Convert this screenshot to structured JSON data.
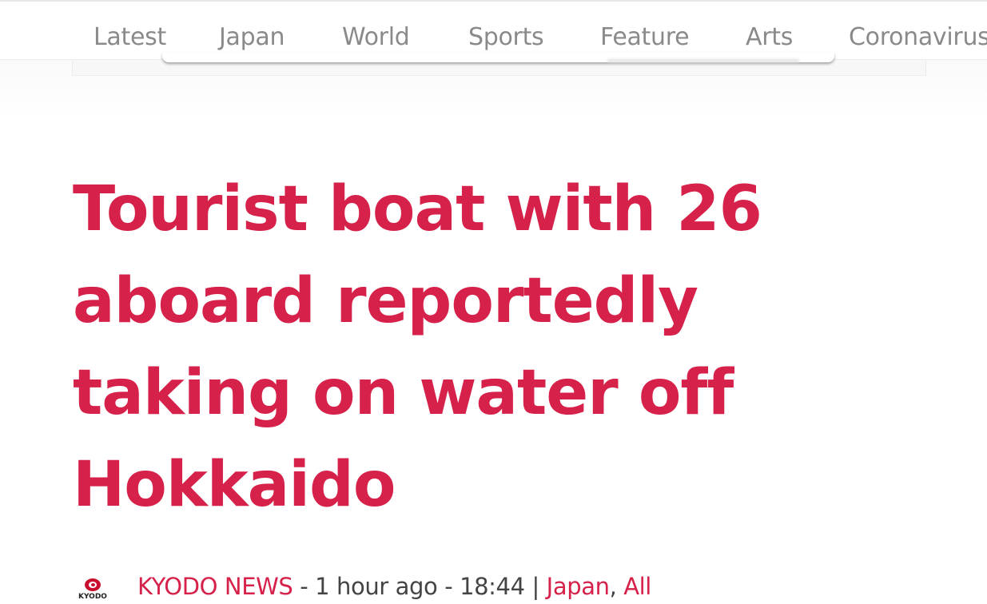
{
  "nav": {
    "items": [
      {
        "label": "Latest"
      },
      {
        "label": "Japan"
      },
      {
        "label": "World"
      },
      {
        "label": "Sports"
      },
      {
        "label": "Feature"
      },
      {
        "label": "Arts"
      },
      {
        "label": "Coronavirus"
      }
    ]
  },
  "article": {
    "headline_lines": [
      "Tourist boat with 26",
      "aboard reportedly",
      "taking on water off",
      "Hokkaido"
    ],
    "byline": {
      "logo_text": "KYODO",
      "source": "KYODO NEWS",
      "sep1": " - ",
      "time_ago": "1 hour ago",
      "sep2": " - ",
      "time": "18:44",
      "sep3": " | ",
      "category1": "Japan",
      "comma": ", ",
      "category2": "All"
    }
  },
  "colors": {
    "accent": "#d6214a",
    "nav_text": "#8a8a8a",
    "body_text": "#444444",
    "logo_red": "#c8102e"
  }
}
